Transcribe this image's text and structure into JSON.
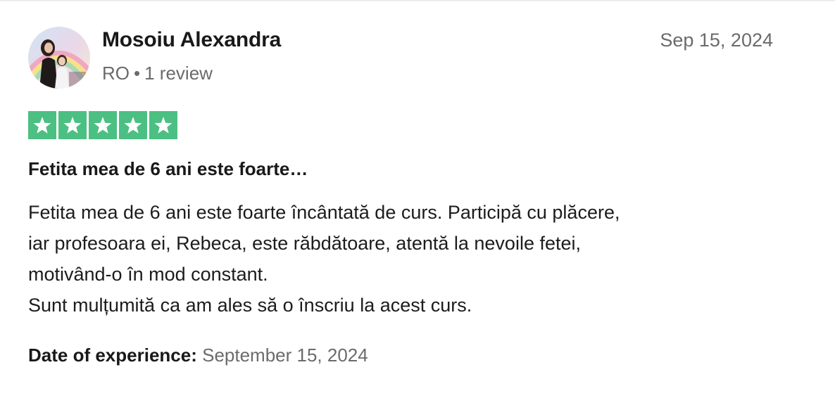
{
  "reviewer": {
    "name": "Mosoiu Alexandra",
    "country": "RO",
    "separator": "•",
    "review_count": "1 review",
    "avatar_icon": "profile-photo-avatar"
  },
  "review": {
    "date": "Sep 15, 2024",
    "rating": 5,
    "rating_max": 5,
    "star_color": "#00b67a",
    "star_color_display": "#4cbf82",
    "title": "Fetita mea de 6 ani este foarte…",
    "body_lines": [
      "Fetita mea de 6 ani este foarte încântată de curs. Participă cu plăcere,",
      "iar profesoara ei, Rebeca, este răbdătoare, atentă la nevoile fetei,",
      "motivând-o în mod constant.",
      "Sunt mulțumită ca am ales să o înscriu la acest curs."
    ],
    "experience_label": "Date of experience:",
    "experience_date": "September 15, 2024"
  }
}
